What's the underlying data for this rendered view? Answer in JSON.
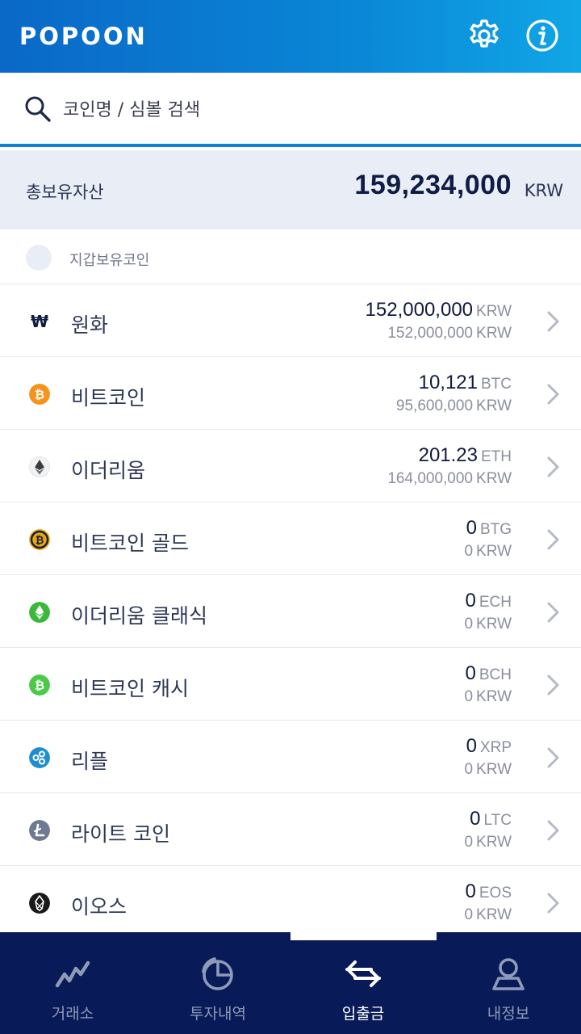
{
  "header": {
    "logo_text": "POPOON",
    "settings_icon": "gear-icon",
    "info_icon": "info-icon"
  },
  "search": {
    "placeholder": "코인명 / 심볼 검색"
  },
  "total": {
    "label": "총보유자산",
    "amount": "159,234,000",
    "unit": "KRW"
  },
  "filter": {
    "label": "지갑보유코인",
    "checked": false
  },
  "coins": [
    {
      "name": "원화",
      "icon": "won-icon",
      "color": "#ffffff",
      "amount": "152,000,000",
      "symbol": "KRW",
      "krw_value": "152,000,000",
      "krw_unit": "KRW"
    },
    {
      "name": "비트코인",
      "icon": "bitcoin-icon",
      "color": "#f7931a",
      "amount": "10,121",
      "symbol": "BTC",
      "krw_value": "95,600,000",
      "krw_unit": "KRW"
    },
    {
      "name": "이더리움",
      "icon": "ethereum-icon",
      "color": "#ecedf0",
      "amount": "201.23",
      "symbol": "ETH",
      "krw_value": "164,000,000",
      "krw_unit": "KRW"
    },
    {
      "name": "비트코인 골드",
      "icon": "bitcoin-gold-icon",
      "color": "#eba809",
      "amount": "0",
      "symbol": "BTG",
      "krw_value": "0",
      "krw_unit": "KRW"
    },
    {
      "name": "이더리움 클래식",
      "icon": "ethereum-classic-icon",
      "color": "#3ab83a",
      "amount": "0",
      "symbol": "ECH",
      "krw_value": "0",
      "krw_unit": "KRW"
    },
    {
      "name": "비트코인 캐시",
      "icon": "bitcoin-cash-icon",
      "color": "#4cc947",
      "amount": "0",
      "symbol": "BCH",
      "krw_value": "0",
      "krw_unit": "KRW"
    },
    {
      "name": "리플",
      "icon": "ripple-icon",
      "color": "#1f8ed0",
      "amount": "0",
      "symbol": "XRP",
      "krw_value": "0",
      "krw_unit": "KRW"
    },
    {
      "name": "라이트 코인",
      "icon": "litecoin-icon",
      "color": "#6e7a91",
      "amount": "0",
      "symbol": "LTC",
      "krw_value": "0",
      "krw_unit": "KRW"
    },
    {
      "name": "이오스",
      "icon": "eos-icon",
      "color": "#1a1a1a",
      "amount": "0",
      "symbol": "EOS",
      "krw_value": "0",
      "krw_unit": "KRW"
    }
  ],
  "nav": {
    "items": [
      {
        "label": "거래소",
        "icon": "trend-chart-icon",
        "active": false
      },
      {
        "label": "투자내역",
        "icon": "pie-chart-icon",
        "active": false
      },
      {
        "label": "입출금",
        "icon": "transfer-arrows-icon",
        "active": true
      },
      {
        "label": "내정보",
        "icon": "user-icon",
        "active": false
      }
    ]
  },
  "colors": {
    "header_start": "#0a68c7",
    "header_end": "#10a6e6",
    "nav_bg": "#081a57",
    "accent": "#0a83d8",
    "total_bg": "#e9eef6"
  }
}
